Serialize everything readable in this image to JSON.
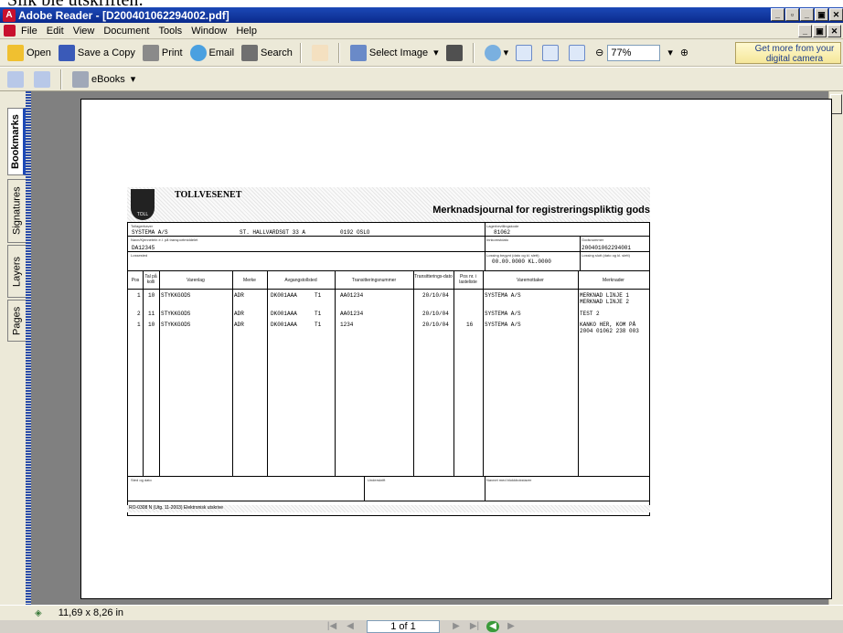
{
  "caption": "Slik ble utskriften:",
  "window": {
    "title": "Adobe Reader - [D200401062294002.pdf]"
  },
  "menu": [
    "File",
    "Edit",
    "View",
    "Document",
    "Tools",
    "Window",
    "Help"
  ],
  "toolbar": {
    "open": "Open",
    "save_copy": "Save a Copy",
    "print": "Print",
    "email": "Email",
    "search": "Search",
    "select_image": "Select Image",
    "zoom": "77%",
    "promo": "Get more from your digital camera",
    "ebooks": "eBooks"
  },
  "side_tabs": [
    "Bookmarks",
    "Signatures",
    "Layers",
    "Pages"
  ],
  "document": {
    "org": "TOLLVESENET",
    "logo_text": "TOLL",
    "title": "Merknadsjournal for registreringspliktig gods",
    "labels": {
      "tollagerhaver": "Tollagerhaver",
      "navn": "Navn/Kjennetein e.l. på transportmiddelet",
      "lossested": "Lossested",
      "lagerbevilling": "Lagerbevillingskode",
      "innkomstdato": "Innkomstdato",
      "godsnummer": "Godsnummer",
      "lossing_begynt": "Lossing begynt (dato og kl. slett)",
      "lossing_slutt": "Lossing slutt (dato og kl. slett)"
    },
    "values": {
      "company": "SYSTEMA A/S",
      "address": "ST. HALLVARDSGT 33 A",
      "postal": "0192 OSLO",
      "vehicle": "DA12345",
      "lagerkode": "81062",
      "godsnummer": "200401062294001",
      "lossing": "00.00.0000     KL.0000"
    },
    "columns": [
      "Pos",
      "Tal på kolli",
      "Varenlag",
      "Merke",
      "Avgangstollsted",
      "Transitteringsnummer",
      "Transitterings-dato",
      "Pos nr. i lasteliste",
      "Varemottaker",
      "Merknader"
    ],
    "rows": [
      {
        "pos": "1",
        "kolli": "10",
        "vare": "STYKKGODS",
        "merke": "ADR",
        "avgang": "DK001AAA",
        "t": "T1",
        "trans": "AA01234",
        "dato": "20/10/04",
        "lastpos": "",
        "mottaker": "SYSTEMA A/S",
        "merk1": "MERKNAD LINJE 1",
        "merk2": "MERKNAD LINJE 2"
      },
      {
        "pos": "2",
        "kolli": "11",
        "vare": "STYKKGODS",
        "merke": "ADR",
        "avgang": "DK001AAA",
        "t": "T1",
        "trans": "AA01234",
        "dato": "20/10/04",
        "lastpos": "",
        "mottaker": "SYSTEMA A/S",
        "merk1": "TEST 2",
        "merk2": ""
      },
      {
        "pos": "1",
        "kolli": "10",
        "vare": "STYKKGODS",
        "merke": "ADR",
        "avgang": "DK001AAA",
        "t": "T1",
        "trans": "1234",
        "dato": "20/10/04",
        "lastpos": "16",
        "mottaker": "SYSTEMA A/S",
        "merk1": "KANKO HER, KOM PÅ",
        "merk2": "2004 01062 238 003"
      }
    ],
    "sign": {
      "sted": "Sted og dato",
      "underskrift": "Underskrift",
      "navn": "Navnet med blokkbokstaver"
    },
    "footnote": "RO-0308 N (Utg. 11-2003) Elektronisk utskrive"
  },
  "status": {
    "page_size": "11,69 x 8,26 in",
    "page_of": "1 of 1"
  },
  "colors": {
    "titlebar": "#0a2a8c",
    "chrome": "#ece9d8",
    "workspace": "#808080"
  }
}
